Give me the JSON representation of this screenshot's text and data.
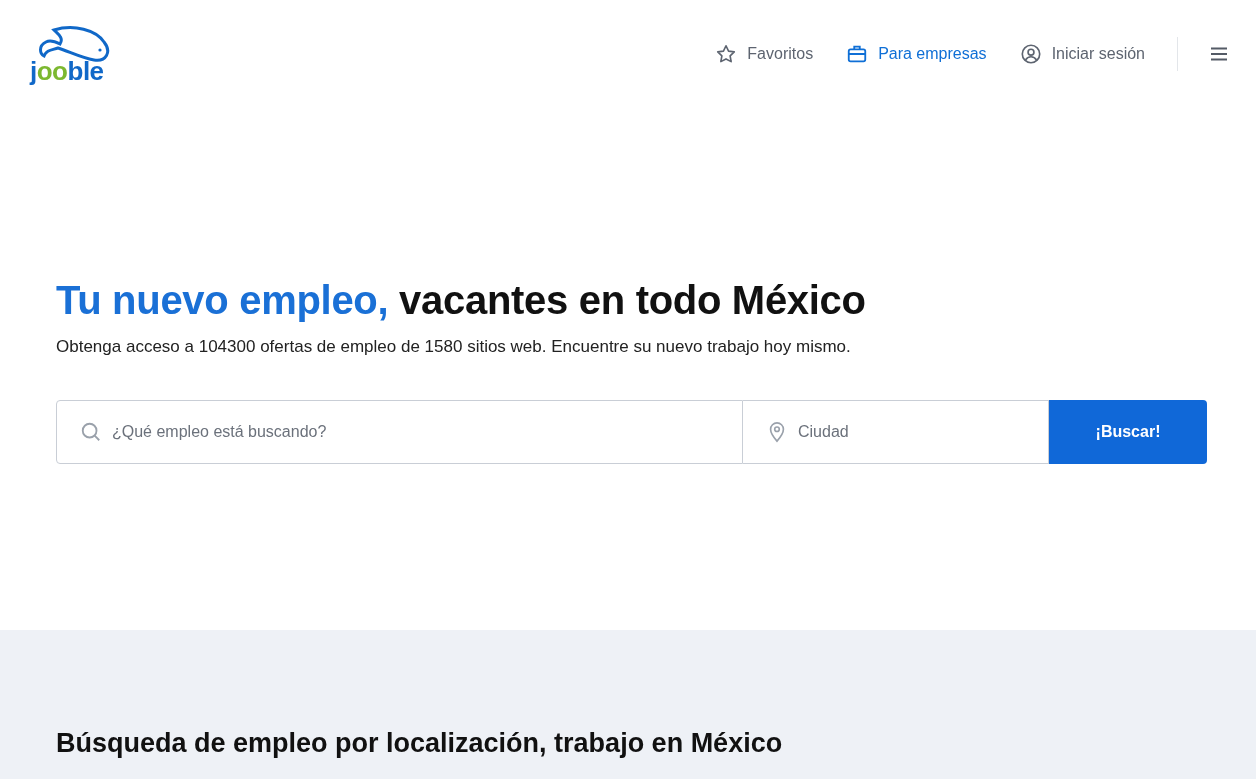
{
  "logo": {
    "text": "jooble"
  },
  "nav": [
    {
      "kind": "star",
      "label": "Favoritos",
      "highlighted": false
    },
    {
      "kind": "briefcase",
      "label": "Para empresas",
      "highlighted": true
    },
    {
      "kind": "user",
      "label": "Iniciar sesión",
      "highlighted": false
    }
  ],
  "hero": {
    "title_accent": "Tu nuevo empleo,",
    "title_rest": "vacantes en todo México",
    "subtitle": "Obtenga acceso a 104300 ofertas de empleo de 1580 sitios web. Encuentre su nuevo trabajo hoy mismo."
  },
  "search": {
    "query_placeholder": "¿Qué empleo está buscando?",
    "city_placeholder": "Ciudad",
    "button": "¡Buscar!"
  },
  "locations": {
    "heading": "Búsqueda de empleo por localización, trabajo en México"
  }
}
